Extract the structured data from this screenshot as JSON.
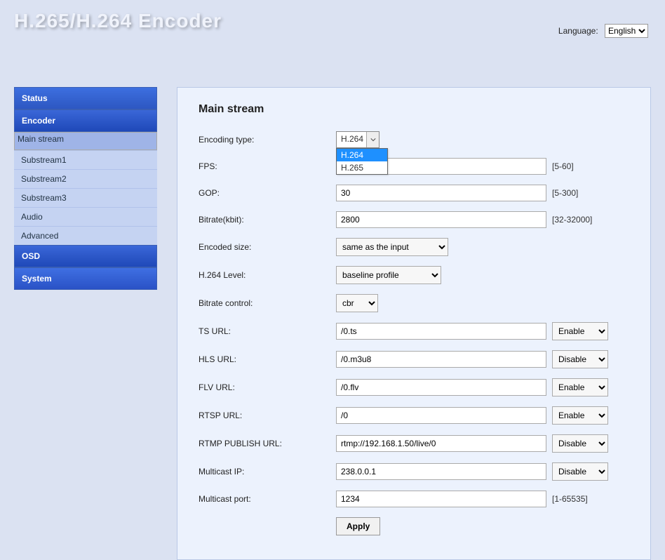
{
  "header": {
    "title": "H.265/H.264 Encoder",
    "language_label": "Language:",
    "language_value": "English"
  },
  "sidebar": {
    "sections": [
      {
        "key": "status",
        "label": "Status"
      },
      {
        "key": "encoder",
        "label": "Encoder"
      },
      {
        "key": "osd",
        "label": "OSD"
      },
      {
        "key": "system",
        "label": "System"
      }
    ],
    "encoder_sub": [
      {
        "label": "Main stream",
        "selected": true
      },
      {
        "label": "Substream1"
      },
      {
        "label": "Substream2"
      },
      {
        "label": "Substream3"
      },
      {
        "label": "Audio"
      },
      {
        "label": "Advanced"
      }
    ]
  },
  "main": {
    "title": "Main stream",
    "encoding_type": {
      "label": "Encoding type:",
      "value": "H.264",
      "options": [
        "H.264",
        "H.265"
      ]
    },
    "fps": {
      "label": "FPS:",
      "value": "",
      "hint": "[5-60]"
    },
    "gop": {
      "label": "GOP:",
      "value": "30",
      "hint": "[5-300]"
    },
    "bitrate": {
      "label": "Bitrate(kbit):",
      "value": "2800",
      "hint": "[32-32000]"
    },
    "encoded_size": {
      "label": "Encoded size:",
      "value": "same as the input"
    },
    "h264_level": {
      "label": "H.264 Level:",
      "value": "baseline profile"
    },
    "bitrate_control": {
      "label": "Bitrate control:",
      "value": "cbr"
    },
    "ts_url": {
      "label": "TS URL:",
      "value": "/0.ts",
      "enable": "Enable"
    },
    "hls_url": {
      "label": "HLS URL:",
      "value": "/0.m3u8",
      "enable": "Disable"
    },
    "flv_url": {
      "label": "FLV URL:",
      "value": "/0.flv",
      "enable": "Enable"
    },
    "rtsp_url": {
      "label": "RTSP URL:",
      "value": "/0",
      "enable": "Enable"
    },
    "rtmp_url": {
      "label": "RTMP PUBLISH URL:",
      "value": "rtmp://192.168.1.50/live/0",
      "enable": "Disable"
    },
    "multicast_ip": {
      "label": "Multicast IP:",
      "value": "238.0.0.1",
      "enable": "Disable"
    },
    "multicast_port": {
      "label": "Multicast port:",
      "value": "1234",
      "hint": "[1-65535]"
    },
    "apply_label": "Apply"
  }
}
